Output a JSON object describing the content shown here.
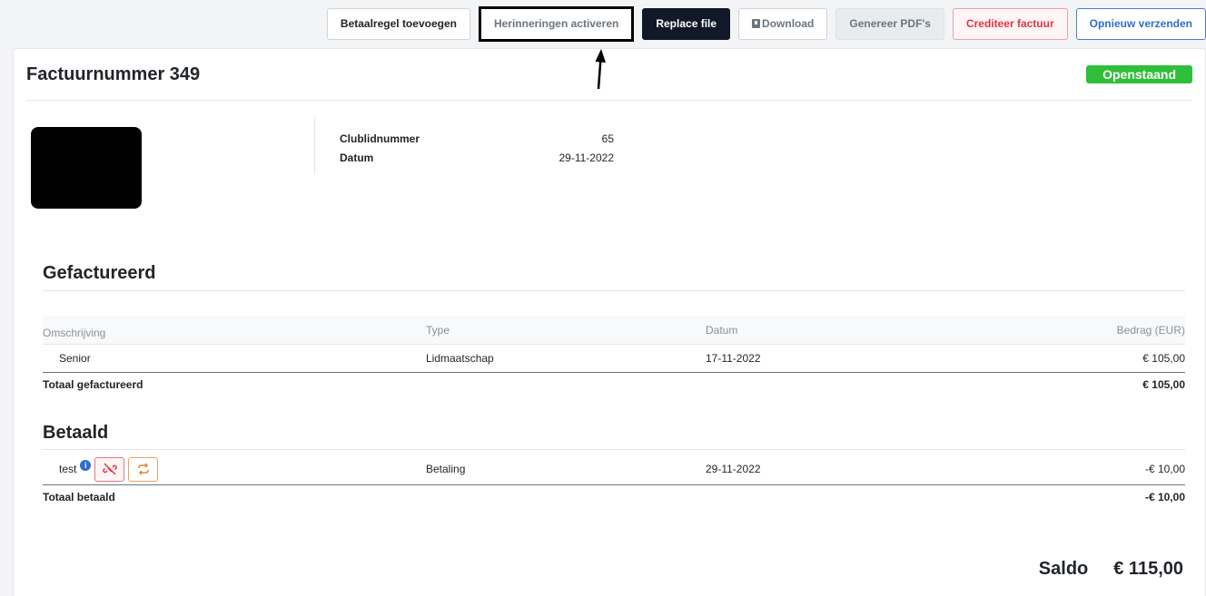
{
  "toolbar": {
    "add_payment_line": "Betaalregel toevoegen",
    "activate_reminders": "Herinneringen activeren",
    "replace_file": "Replace file",
    "download": "Download",
    "generate_pdfs": "Genereer PDF's",
    "credit_invoice": "Crediteer factuur",
    "resend": "Opnieuw verzenden"
  },
  "invoice": {
    "title": "Factuurnummer 349",
    "status": "Openstaand",
    "meta": [
      {
        "label": "Clublidnummer",
        "value": "65"
      },
      {
        "label": "Datum",
        "value": "29-11-2022"
      }
    ]
  },
  "billed": {
    "title": "Gefactureerd",
    "headers": {
      "description": "Omschrijving",
      "type": "Type",
      "date": "Datum",
      "amount": "Bedrag (EUR)"
    },
    "rows": [
      {
        "description": "Senior",
        "type": "Lidmaatschap",
        "date": "17-11-2022",
        "amount": "€ 105,00"
      }
    ],
    "total_label": "Totaal gefactureerd",
    "total_value": "€ 105,00"
  },
  "paid": {
    "title": "Betaald",
    "rows": [
      {
        "description": "test",
        "type": "Betaling",
        "date": "29-11-2022",
        "amount": "-€ 10,00"
      }
    ],
    "total_label": "Totaal betaald",
    "total_value": "-€ 10,00"
  },
  "saldo": {
    "label": "Saldo",
    "value": "€ 115,00"
  },
  "icons": {
    "info": "info-icon",
    "unlink": "unlink-icon",
    "repeat": "repeat-icon",
    "download": "download-icon"
  },
  "colors": {
    "status": "#2fbf3a",
    "danger": "#dc3545",
    "primary": "#2f6fc7",
    "dark": "#111827",
    "orange": "#e8812e"
  }
}
